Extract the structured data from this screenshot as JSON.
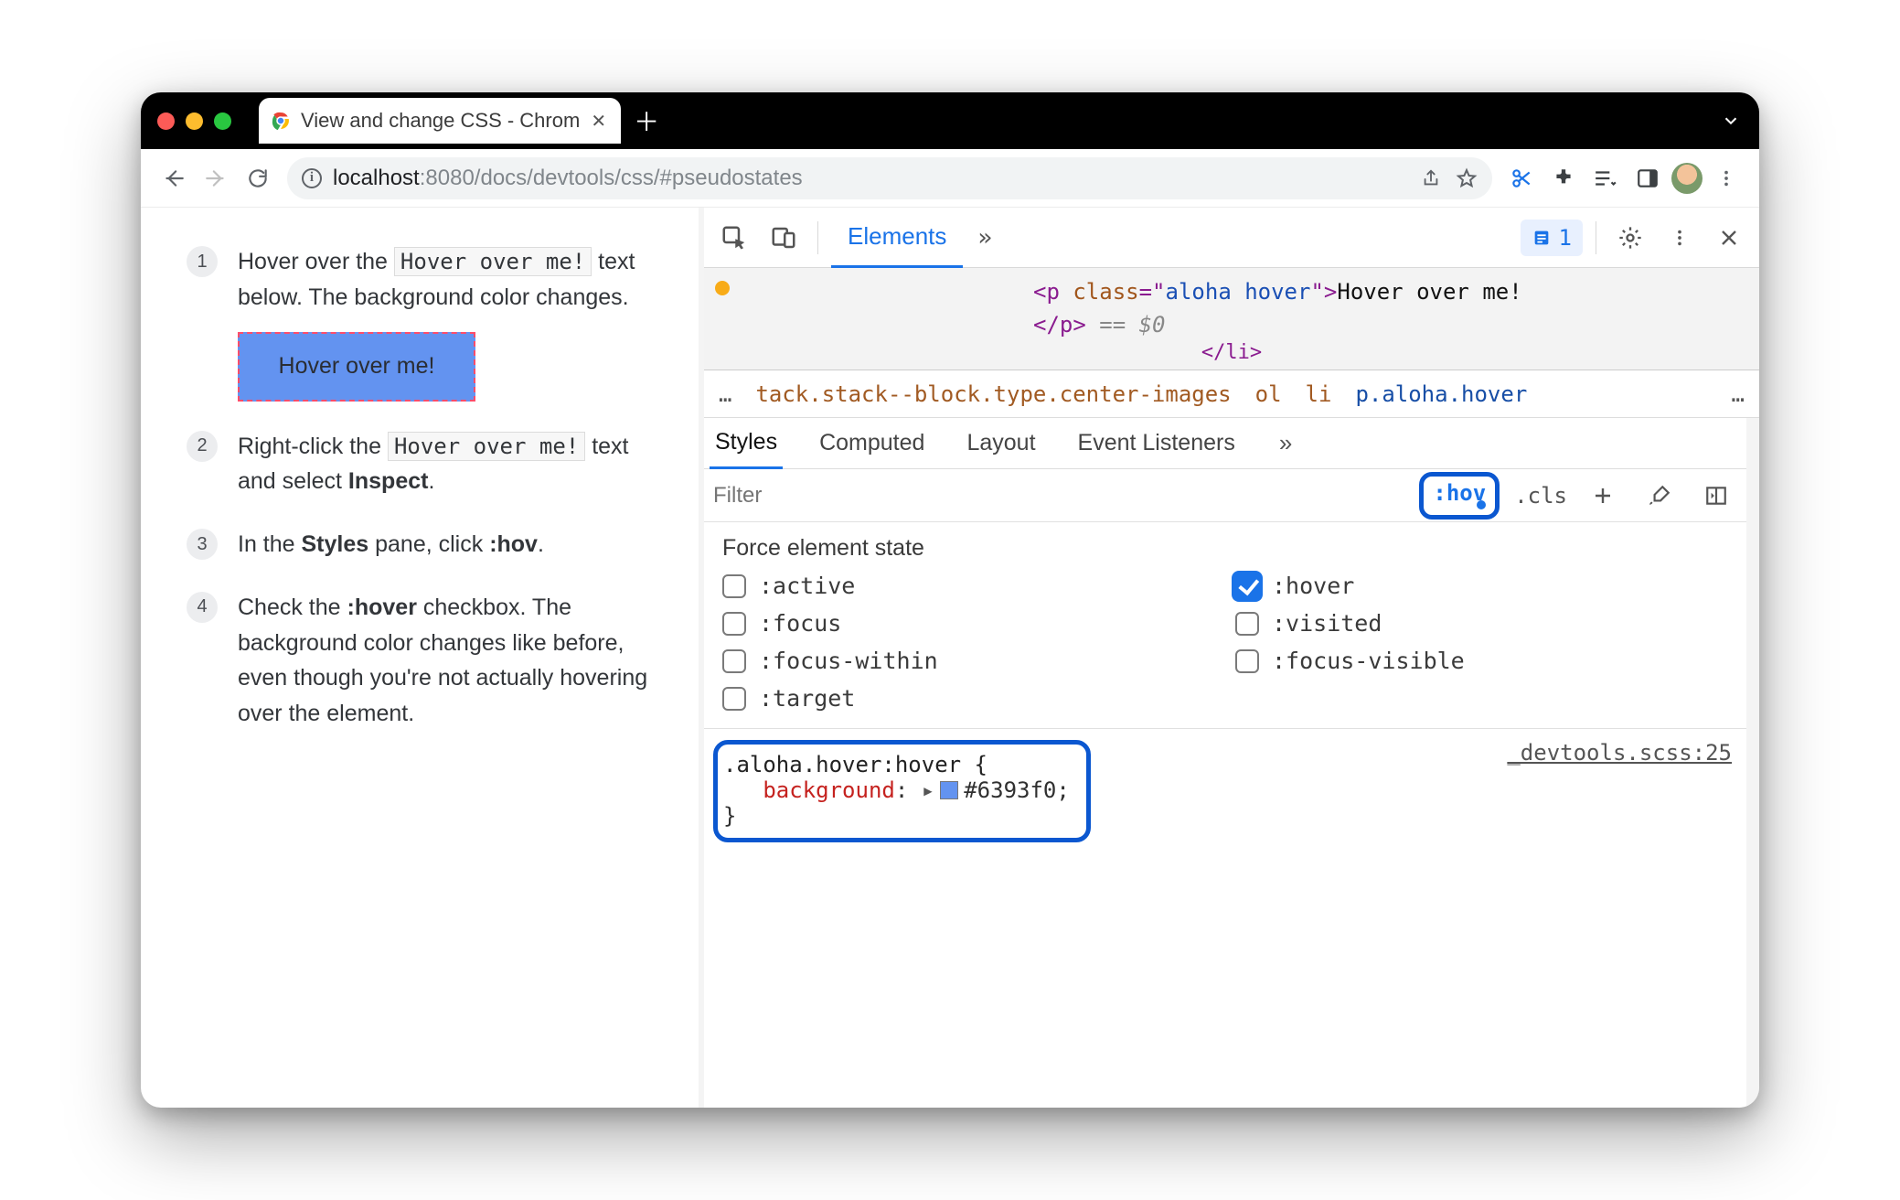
{
  "tab": {
    "title": "View and change CSS - Chrom"
  },
  "url": {
    "host": "localhost",
    "port": ":8080",
    "path": "/docs/devtools/css/#pseudostates"
  },
  "doc": {
    "step1_a": "Hover over the ",
    "step1_code": "Hover over me!",
    "step1_b": " text below. The background color changes.",
    "hover_demo": "Hover over me!",
    "step2_a": "Right-click the ",
    "step2_code": "Hover over me!",
    "step2_b": " text and select ",
    "step2_bold": "Inspect",
    "step3_a": "In the ",
    "step3_bold1": "Styles",
    "step3_b": " pane, click ",
    "step3_bold2": ":hov",
    "step4_a": "Check the ",
    "step4_bold": ":hover",
    "step4_b": " checkbox. The background color changes like before, even though you're not actually hovering over the element."
  },
  "devtools": {
    "panel": "Elements",
    "issues_count": "1",
    "dom": {
      "open": "<p ",
      "classkw": "class",
      "eq": "=\"",
      "classval": "aloha hover",
      "endopen": "\">",
      "text": "Hover over me!",
      "close": "</p>",
      "eqzero": " == $0",
      "endli": "</li>"
    },
    "crumbs": {
      "dots": "…",
      "a": "tack.stack--block.type.center-images",
      "b": "ol",
      "c": "li",
      "d": "p.aloha.hover",
      "end": "…"
    },
    "tabs": {
      "styles": "Styles",
      "computed": "Computed",
      "layout": "Layout",
      "evl": "Event Listeners"
    },
    "filter": {
      "placeholder": "Filter",
      "hov": ":hov",
      "cls": ".cls"
    },
    "force": {
      "title": "Force element state",
      "states": {
        "active": ":active",
        "hover": ":hover",
        "focus": ":focus",
        "visited": ":visited",
        "focusw": ":focus-within",
        "focusv": ":focus-visible",
        "target": ":target"
      }
    },
    "rule": {
      "selector": ".aloha.hover:hover {",
      "prop": "background",
      "colon": ":",
      "value": "#6393f0;",
      "close": "}",
      "source": "_devtools.scss:25"
    }
  }
}
